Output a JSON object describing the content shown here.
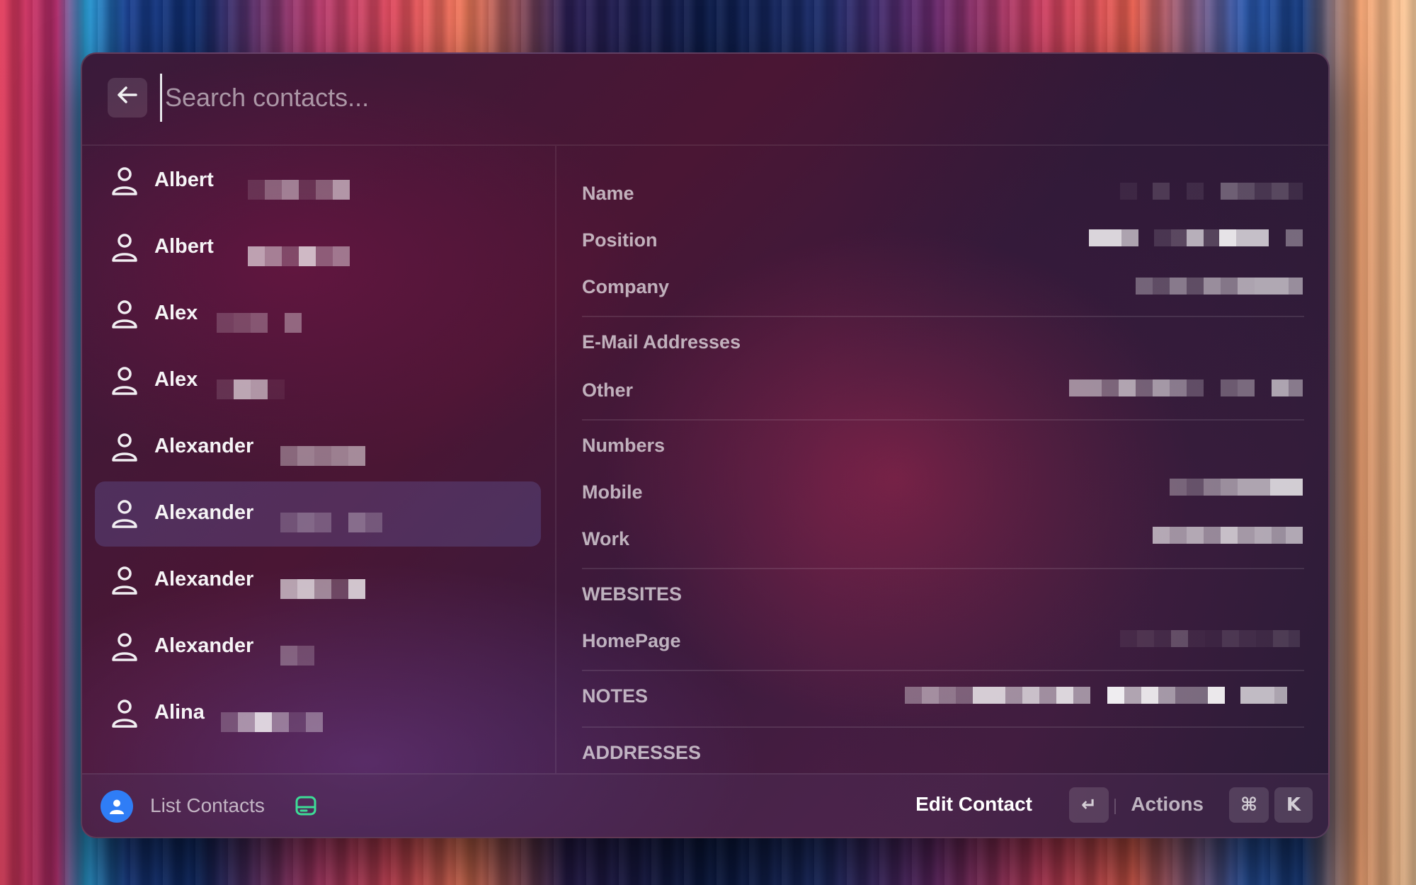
{
  "search": {
    "placeholder": "Search contacts..."
  },
  "contacts": [
    {
      "name": "Albert"
    },
    {
      "name": "Albert"
    },
    {
      "name": "Alex"
    },
    {
      "name": "Alex"
    },
    {
      "name": "Alexander"
    },
    {
      "name": "Alexander",
      "selected": true
    },
    {
      "name": "Alexander"
    },
    {
      "name": "Alexander"
    },
    {
      "name": "Alina"
    }
  ],
  "details": {
    "name_label": "Name",
    "position_label": "Position",
    "company_label": "Company",
    "email_section": "E-Mail Addresses",
    "email_other_label": "Other",
    "numbers_section": "Numbers",
    "mobile_label": "Mobile",
    "work_label": "Work",
    "websites_section": "WEBSITES",
    "homepage_label": "HomePage",
    "notes_section": "NOTES",
    "addresses_section": "ADDRESSES"
  },
  "footer": {
    "title": "List Contacts",
    "primary_action": "Edit Contact",
    "primary_shortcut": "↵",
    "actions_label": "Actions",
    "actions_shortcut_mod": "⌘",
    "actions_shortcut_key": "K"
  },
  "icons": {
    "back": "arrow-left-icon",
    "contact": "person-icon",
    "app": "contacts-app-icon",
    "storage": "hard-drive-icon"
  },
  "colors": {
    "accent": "#2f7df6",
    "storage_icon": "#3ddc97",
    "selection": "#5e5ea8"
  }
}
